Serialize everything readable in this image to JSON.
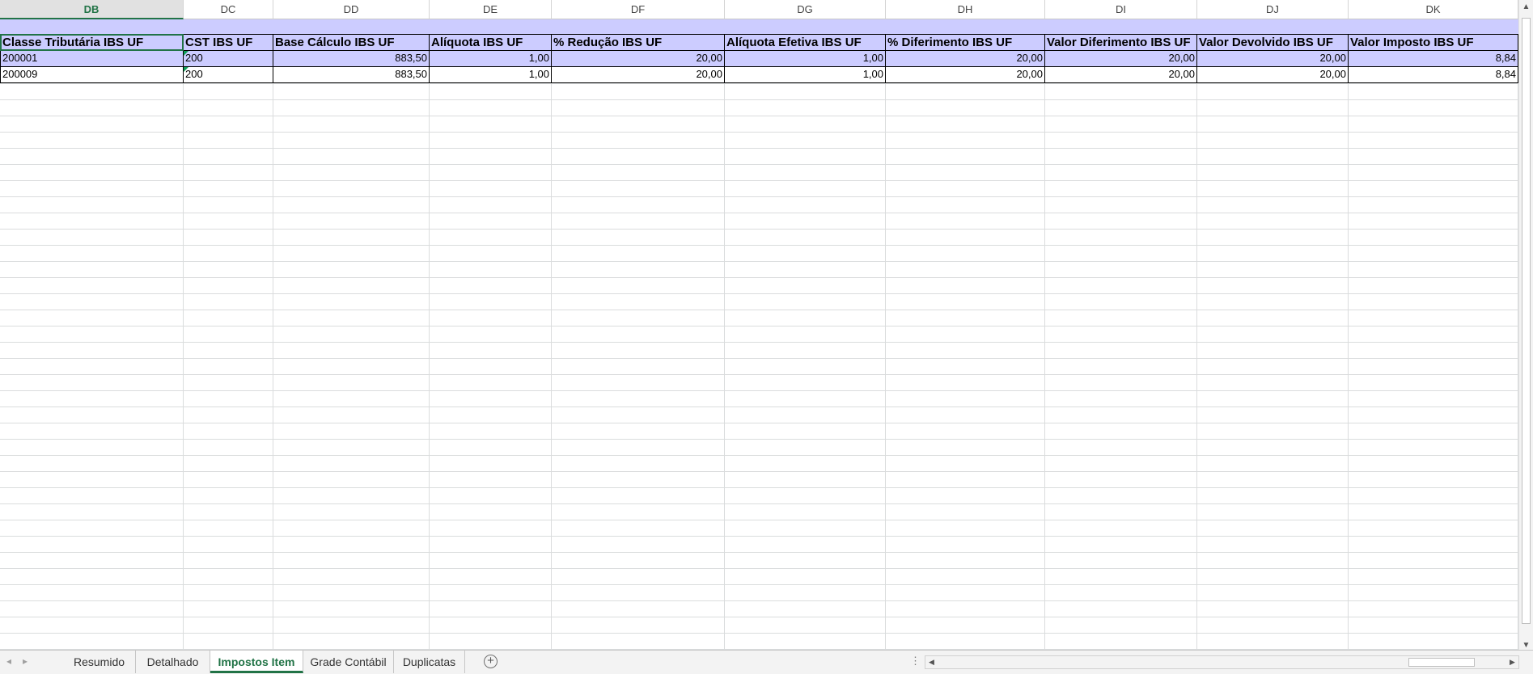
{
  "columns": [
    {
      "letter": "DB",
      "header": "Classe Tributária IBS UF",
      "values": [
        "200001",
        "200009"
      ]
    },
    {
      "letter": "DC",
      "header": "CST IBS UF",
      "values": [
        "200",
        "200"
      ]
    },
    {
      "letter": "DD",
      "header": "Base Cálculo IBS UF",
      "values": [
        "883,50",
        "883,50"
      ]
    },
    {
      "letter": "DE",
      "header": "Alíquota IBS UF",
      "values": [
        "1,00",
        "1,00"
      ]
    },
    {
      "letter": "DF",
      "header": "% Redução IBS UF",
      "values": [
        "20,00",
        "20,00"
      ]
    },
    {
      "letter": "DG",
      "header": "Alíquota Efetiva IBS UF",
      "values": [
        "1,00",
        "1,00"
      ]
    },
    {
      "letter": "DH",
      "header": "% Diferimento IBS UF",
      "values": [
        "20,00",
        "20,00"
      ]
    },
    {
      "letter": "DI",
      "header": "Valor Diferimento IBS UF",
      "values": [
        "20,00",
        "20,00"
      ]
    },
    {
      "letter": "DJ",
      "header": "Valor Devolvido IBS UF",
      "values": [
        "20,00",
        "20,00"
      ]
    },
    {
      "letter": "DK",
      "header": "Valor Imposto IBS UF",
      "values": [
        "8,84",
        "8,84"
      ]
    }
  ],
  "selected_column": "DB",
  "sheet_tabs": [
    {
      "label": "Resumido",
      "active": false
    },
    {
      "label": "Detalhado",
      "active": false
    },
    {
      "label": "Impostos Item",
      "active": true
    },
    {
      "label": "Grade Contábil",
      "active": false
    },
    {
      "label": "Duplicatas",
      "active": false
    }
  ],
  "icons": {
    "add_sheet": "plus-circle-icon",
    "scroll_left": "triangle-left-icon",
    "scroll_right": "triangle-right-icon",
    "scroll_up": "triangle-up-icon",
    "scroll_down": "triangle-down-icon",
    "more": "ellipsis-icon"
  },
  "colors": {
    "accent": "#217346",
    "header_fill": "#ccccff",
    "row_fill": "#ccccff"
  }
}
